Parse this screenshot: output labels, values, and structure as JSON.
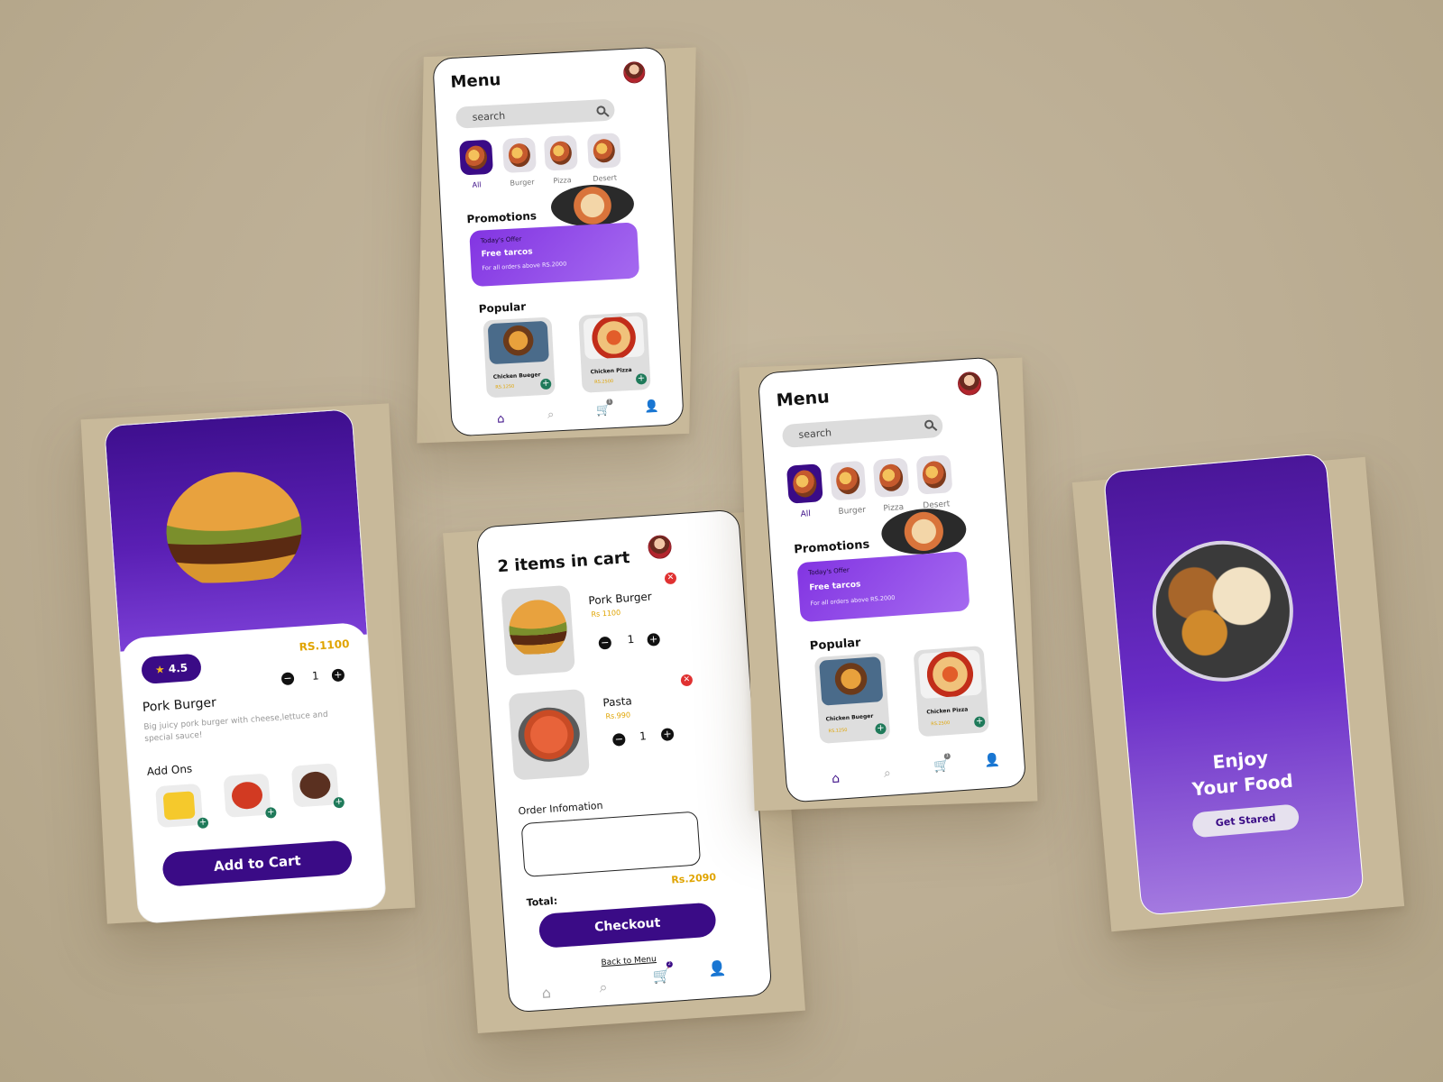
{
  "menu_screen": {
    "title": "Menu",
    "search_placeholder": "search",
    "categories": [
      {
        "label": "All",
        "active": true
      },
      {
        "label": "Burger",
        "active": false
      },
      {
        "label": "Pizza",
        "active": false
      },
      {
        "label": "Desert",
        "active": false
      }
    ],
    "promotions_title": "Promotions",
    "promo": {
      "tag": "Today's Offer",
      "headline": "Free tarcos",
      "subtext": "For all orders above RS.2000"
    },
    "popular_title": "Popular",
    "popular_items": [
      {
        "name": "Chicken Bueger",
        "price": "RS.1250"
      },
      {
        "name": "Chicken Pizza",
        "price": "RS.2500"
      }
    ],
    "cart_badge": "1"
  },
  "detail_screen": {
    "rating": "4.5",
    "price": "RS.1100",
    "quantity": "1",
    "name": "Pork Burger",
    "description": "Big juicy pork burger with cheese,lettuce and special sauce!",
    "addons_title": "Add Ons",
    "cta": "Add to Cart"
  },
  "cart_screen": {
    "title": "2 items in cart",
    "items": [
      {
        "name": "Pork Burger",
        "price": "Rs 1100",
        "quantity": "1"
      },
      {
        "name": "Pasta",
        "price": "Rs.990",
        "quantity": "1"
      }
    ],
    "order_info_label": "Order Infomation",
    "total_label": "Total:",
    "total_value": "Rs.2090",
    "checkout": "Checkout",
    "back_link": "Back to Menu",
    "cart_badge": "2"
  },
  "splash_screen": {
    "line1": "Enjoy",
    "line2": "Your Food",
    "cta": "Get Stared"
  },
  "colors": {
    "brand_purple": "#3a0b86",
    "promo_purple": "#8234e2",
    "price_gold": "#e0a400",
    "add_green": "#1f7a5a",
    "remove_red": "#e03131",
    "background": "#bcae94"
  }
}
